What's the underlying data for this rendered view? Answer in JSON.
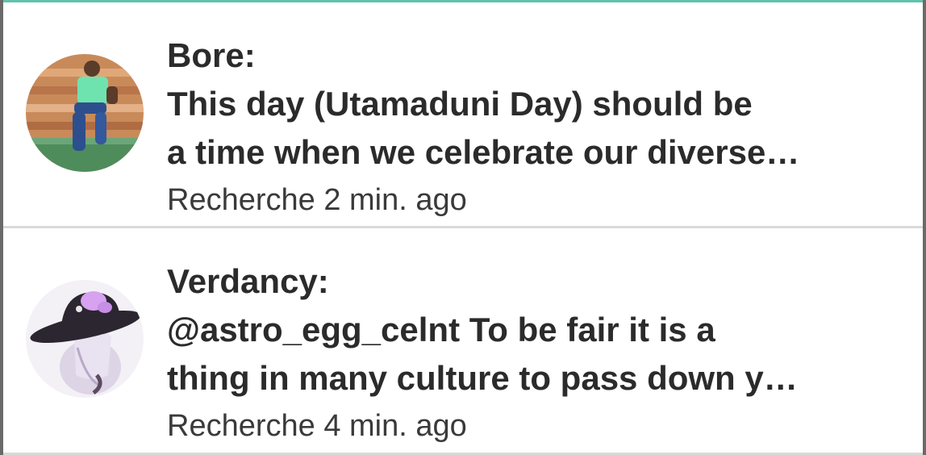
{
  "feed": {
    "items": [
      {
        "author": "Bore:",
        "message_line1": "This day (Utamaduni Day) should be",
        "message_line2": "a time when we celebrate our diverse…",
        "community": "Recherche",
        "time": "2 min. ago",
        "avatar_icon": "avatar-person-on-bench-icon"
      },
      {
        "author": "Verdancy:",
        "message_line1": "@astro_egg_celnt To be fair it is a",
        "message_line2": "thing in many culture to pass down y…",
        "community": "Recherche",
        "time": "4 min. ago",
        "avatar_icon": "avatar-anime-hat-icon"
      }
    ]
  },
  "colors": {
    "accent": "#5fc3ae",
    "text": "#2b2b2b",
    "divider": "#d9d9d9"
  }
}
